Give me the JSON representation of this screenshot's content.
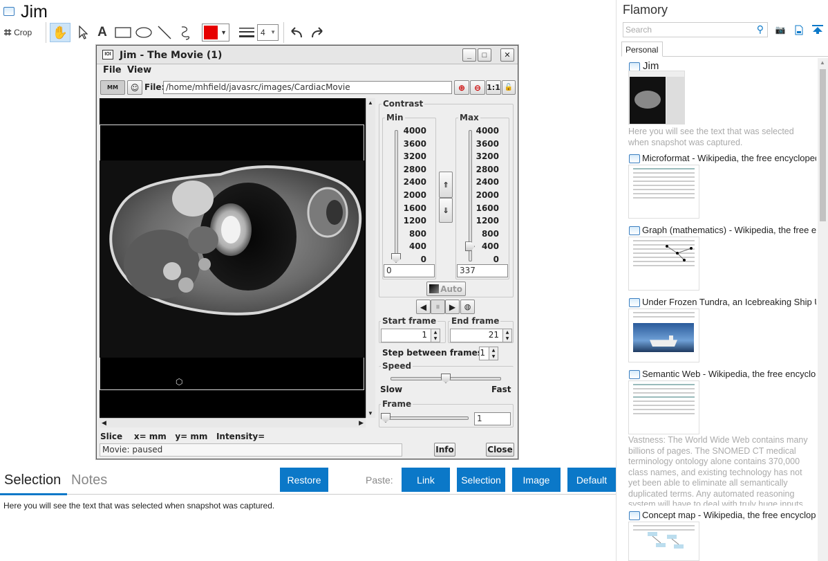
{
  "header": {
    "title": "Jim",
    "crop_label": "Crop",
    "line_width": "4",
    "color": "#e60000"
  },
  "java_window": {
    "title": "Jim - The Movie (1)",
    "menu": [
      "File",
      "View"
    ],
    "mm_label": "MM",
    "file_label": "File:",
    "file_path": "/home/mhfield/javasrc/images/CardiacMovie",
    "one_to_one": "1:1",
    "contrast_label": "Contrast",
    "min_label": "Min",
    "max_label": "Max",
    "scale": [
      "4000",
      "3600",
      "3200",
      "2800",
      "2400",
      "2000",
      "1600",
      "1200",
      "800",
      "400",
      "0"
    ],
    "min_value": "0",
    "max_value": "337",
    "max_slider_fraction": 0.084,
    "auto_label": "Auto",
    "start_frame_label": "Start frame",
    "end_frame_label": "End frame",
    "start_frame": "1",
    "end_frame": "21",
    "step_label": "Step between frames:",
    "step_value": "1",
    "speed_label": "Speed",
    "slow_label": "Slow",
    "fast_label": "Fast",
    "speed_fraction": 0.5,
    "frame_label": "Frame",
    "frame_value": "1",
    "status_bar": "Slice    x= mm   y= mm   Intensity=",
    "movie_status": "Movie: paused",
    "info_label": "Info",
    "close_label": "Close"
  },
  "bottom": {
    "tabs": [
      "Selection",
      "Notes"
    ],
    "restore_label": "Restore",
    "paste_label": "Paste:",
    "paste_buttons": [
      "Link",
      "Selection",
      "Image",
      "Default"
    ],
    "selection_text": "Here you will see the text that was selected when snapshot was captured."
  },
  "sidebar": {
    "app_title": "Flamory",
    "search_placeholder": "Search",
    "tab": "Personal",
    "items": [
      {
        "title": "Jim",
        "desc": "Here you will see the text that was selected when snapshot was captured."
      },
      {
        "title": "Microformat - Wikipedia, the free encyclopedia"
      },
      {
        "title": "Graph (mathematics) - Wikipedia, the free encyclopedia"
      },
      {
        "title": "Under Frozen Tundra, an Icebreaking Ship Uncovers"
      },
      {
        "title": "Semantic Web - Wikipedia, the free encyclopedia",
        "desc": "Vastness: The World Wide Web contains many billions of pages. The SNOMED CT medical terminology ontology alone contains 370,000 class names, and existing technology has not yet been able to eliminate all semantically duplicated terms. Any automated reasoning system will have to deal with truly huge inputs."
      },
      {
        "title": "Concept map - Wikipedia, the free encyclopedia"
      }
    ]
  }
}
